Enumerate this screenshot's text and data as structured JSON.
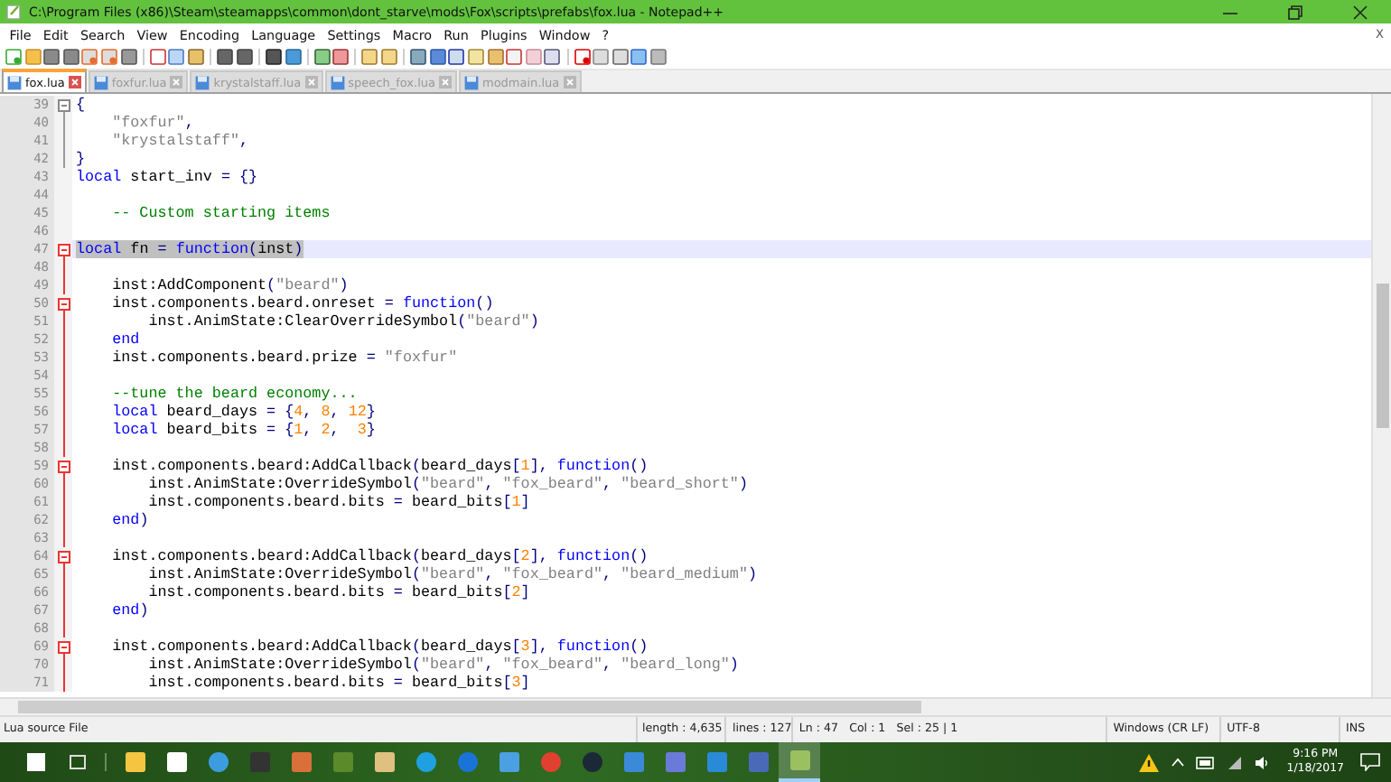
{
  "window": {
    "title": "C:\\Program Files (x86)\\Steam\\steamapps\\common\\dont_starve\\mods\\Fox\\scripts\\prefabs\\fox.lua - Notepad++"
  },
  "menu": [
    "File",
    "Edit",
    "Search",
    "View",
    "Encoding",
    "Language",
    "Settings",
    "Macro",
    "Run",
    "Plugins",
    "Window",
    "?"
  ],
  "menu_close": "X",
  "tabs": [
    {
      "label": "fox.lua",
      "selected": true
    },
    {
      "label": "foxfur.lua",
      "selected": false
    },
    {
      "label": "krystalstaff.lua",
      "selected": false
    },
    {
      "label": "speech_fox.lua",
      "selected": false
    },
    {
      "label": "modmain.lua",
      "selected": false
    }
  ],
  "lines": [
    {
      "n": "39",
      "fold_box": true,
      "fold_line": true,
      "fold_active": false,
      "selected": false,
      "tokens": [
        {
          "kind": "op",
          "text": "{"
        }
      ]
    },
    {
      "n": "40",
      "fold_box": false,
      "fold_line": true,
      "fold_active": false,
      "selected": false,
      "tokens": [
        {
          "kind": "str",
          "text": "    \"foxfur\""
        },
        {
          "kind": "op",
          "text": ","
        }
      ]
    },
    {
      "n": "41",
      "fold_box": false,
      "fold_line": true,
      "fold_active": false,
      "selected": false,
      "tokens": [
        {
          "kind": "str",
          "text": "    \"krystalstaff\""
        },
        {
          "kind": "op",
          "text": ","
        }
      ]
    },
    {
      "n": "42",
      "fold_box": false,
      "fold_line": true,
      "fold_active": false,
      "selected": false,
      "tokens": [
        {
          "kind": "op",
          "text": "}"
        }
      ]
    },
    {
      "n": "43",
      "fold_box": false,
      "fold_line": false,
      "selected": false,
      "tokens": [
        {
          "kind": "kw",
          "text": "local"
        },
        {
          "kind": "id",
          "text": " start_inv "
        },
        {
          "kind": "op",
          "text": "= {}"
        }
      ]
    },
    {
      "n": "44",
      "fold_box": false,
      "fold_line": false,
      "selected": false
    },
    {
      "n": "45",
      "fold_box": false,
      "fold_line": false,
      "selected": false,
      "tokens": [
        {
          "kind": "cmt",
          "text": "    -- Custom starting items"
        }
      ]
    },
    {
      "n": "46",
      "fold_box": false,
      "fold_line": false,
      "selected": false
    },
    {
      "n": "47",
      "fold_box": true,
      "fold_line": true,
      "fold_active": true,
      "selected": true,
      "tokens": [
        {
          "kind": "kw",
          "text": "local"
        },
        {
          "kind": "id",
          "text": " fn "
        },
        {
          "kind": "op",
          "text": "= "
        },
        {
          "kind": "kw",
          "text": "function"
        },
        {
          "kind": "op",
          "text": "("
        },
        {
          "kind": "id",
          "text": "inst"
        },
        {
          "kind": "op",
          "text": ")"
        }
      ]
    },
    {
      "n": "48",
      "fold_box": false,
      "fold_line": true,
      "fold_active": true,
      "selected": false
    },
    {
      "n": "49",
      "fold_box": false,
      "fold_line": true,
      "fold_active": true,
      "selected": false,
      "tokens": [
        {
          "kind": "id",
          "text": "    inst:AddComponent"
        },
        {
          "kind": "op",
          "text": "("
        },
        {
          "kind": "str",
          "text": "\"beard\""
        },
        {
          "kind": "op",
          "text": ")"
        }
      ]
    },
    {
      "n": "50",
      "fold_box": true,
      "fold_line": true,
      "fold_active": true,
      "selected": false,
      "tokens": [
        {
          "kind": "id",
          "text": "    inst.components.beard.onreset "
        },
        {
          "kind": "op",
          "text": "= "
        },
        {
          "kind": "kw",
          "text": "function"
        },
        {
          "kind": "op",
          "text": "()"
        }
      ]
    },
    {
      "n": "51",
      "fold_box": false,
      "fold_line": true,
      "fold_active": true,
      "selected": false,
      "tokens": [
        {
          "kind": "id",
          "text": "        inst.AnimState:ClearOverrideSymbol"
        },
        {
          "kind": "op",
          "text": "("
        },
        {
          "kind": "str",
          "text": "\"beard\""
        },
        {
          "kind": "op",
          "text": ")"
        }
      ]
    },
    {
      "n": "52",
      "fold_box": false,
      "fold_line": true,
      "fold_active": true,
      "selected": false,
      "tokens": [
        {
          "kind": "kw",
          "text": "    end"
        }
      ]
    },
    {
      "n": "53",
      "fold_box": false,
      "fold_line": true,
      "fold_active": true,
      "selected": false,
      "tokens": [
        {
          "kind": "id",
          "text": "    inst.components.beard.prize "
        },
        {
          "kind": "op",
          "text": "= "
        },
        {
          "kind": "str",
          "text": "\"foxfur\""
        }
      ]
    },
    {
      "n": "54",
      "fold_box": false,
      "fold_line": true,
      "fold_active": true,
      "selected": false
    },
    {
      "n": "55",
      "fold_box": false,
      "fold_line": true,
      "fold_active": true,
      "selected": false,
      "tokens": [
        {
          "kind": "cmt",
          "text": "    --tune the beard economy..."
        }
      ]
    },
    {
      "n": "56",
      "fold_box": false,
      "fold_line": true,
      "fold_active": true,
      "selected": false,
      "tokens": [
        {
          "kind": "kw",
          "text": "    local"
        },
        {
          "kind": "id",
          "text": " beard_days "
        },
        {
          "kind": "op",
          "text": "= {"
        },
        {
          "kind": "num",
          "text": "4"
        },
        {
          "kind": "op",
          "text": ", "
        },
        {
          "kind": "num",
          "text": "8"
        },
        {
          "kind": "op",
          "text": ", "
        },
        {
          "kind": "num",
          "text": "12"
        },
        {
          "kind": "op",
          "text": "}"
        }
      ]
    },
    {
      "n": "57",
      "fold_box": false,
      "fold_line": true,
      "fold_active": true,
      "selected": false,
      "tokens": [
        {
          "kind": "kw",
          "text": "    local"
        },
        {
          "kind": "id",
          "text": " beard_bits "
        },
        {
          "kind": "op",
          "text": "= {"
        },
        {
          "kind": "num",
          "text": "1"
        },
        {
          "kind": "op",
          "text": ", "
        },
        {
          "kind": "num",
          "text": "2"
        },
        {
          "kind": "op",
          "text": ",  "
        },
        {
          "kind": "num",
          "text": "3"
        },
        {
          "kind": "op",
          "text": "}"
        }
      ]
    },
    {
      "n": "58",
      "fold_box": false,
      "fold_line": true,
      "fold_active": true,
      "selected": false
    },
    {
      "n": "59",
      "fold_box": true,
      "fold_line": true,
      "fold_active": true,
      "selected": false,
      "tokens": [
        {
          "kind": "id",
          "text": "    inst.components.beard:AddCallback"
        },
        {
          "kind": "op",
          "text": "("
        },
        {
          "kind": "id",
          "text": "beard_days"
        },
        {
          "kind": "op",
          "text": "["
        },
        {
          "kind": "num",
          "text": "1"
        },
        {
          "kind": "op",
          "text": "], "
        },
        {
          "kind": "kw",
          "text": "function"
        },
        {
          "kind": "op",
          "text": "()"
        }
      ]
    },
    {
      "n": "60",
      "fold_box": false,
      "fold_line": true,
      "fold_active": true,
      "selected": false,
      "tokens": [
        {
          "kind": "id",
          "text": "        inst.AnimState:OverrideSymbol"
        },
        {
          "kind": "op",
          "text": "("
        },
        {
          "kind": "str",
          "text": "\"beard\""
        },
        {
          "kind": "op",
          "text": ", "
        },
        {
          "kind": "str",
          "text": "\"fox_beard\""
        },
        {
          "kind": "op",
          "text": ", "
        },
        {
          "kind": "str",
          "text": "\"beard_short\""
        },
        {
          "kind": "op",
          "text": ")"
        }
      ]
    },
    {
      "n": "61",
      "fold_box": false,
      "fold_line": true,
      "fold_active": true,
      "selected": false,
      "tokens": [
        {
          "kind": "id",
          "text": "        inst.components.beard.bits "
        },
        {
          "kind": "op",
          "text": "= "
        },
        {
          "kind": "id",
          "text": "beard_bits"
        },
        {
          "kind": "op",
          "text": "["
        },
        {
          "kind": "num",
          "text": "1"
        },
        {
          "kind": "op",
          "text": "]"
        }
      ]
    },
    {
      "n": "62",
      "fold_box": false,
      "fold_line": true,
      "fold_active": true,
      "selected": false,
      "tokens": [
        {
          "kind": "kw",
          "text": "    end"
        },
        {
          "kind": "op",
          "text": ")"
        }
      ]
    },
    {
      "n": "63",
      "fold_box": false,
      "fold_line": true,
      "fold_active": true,
      "selected": false
    },
    {
      "n": "64",
      "fold_box": true,
      "fold_line": true,
      "fold_active": true,
      "selected": false,
      "tokens": [
        {
          "kind": "id",
          "text": "    inst.components.beard:AddCallback"
        },
        {
          "kind": "op",
          "text": "("
        },
        {
          "kind": "id",
          "text": "beard_days"
        },
        {
          "kind": "op",
          "text": "["
        },
        {
          "kind": "num",
          "text": "2"
        },
        {
          "kind": "op",
          "text": "], "
        },
        {
          "kind": "kw",
          "text": "function"
        },
        {
          "kind": "op",
          "text": "()"
        }
      ]
    },
    {
      "n": "65",
      "fold_box": false,
      "fold_line": true,
      "fold_active": true,
      "selected": false,
      "tokens": [
        {
          "kind": "id",
          "text": "        inst.AnimState:OverrideSymbol"
        },
        {
          "kind": "op",
          "text": "("
        },
        {
          "kind": "str",
          "text": "\"beard\""
        },
        {
          "kind": "op",
          "text": ", "
        },
        {
          "kind": "str",
          "text": "\"fox_beard\""
        },
        {
          "kind": "op",
          "text": ", "
        },
        {
          "kind": "str",
          "text": "\"beard_medium\""
        },
        {
          "kind": "op",
          "text": ")"
        }
      ]
    },
    {
      "n": "66",
      "fold_box": false,
      "fold_line": true,
      "fold_active": true,
      "selected": false,
      "tokens": [
        {
          "kind": "id",
          "text": "        inst.components.beard.bits "
        },
        {
          "kind": "op",
          "text": "= "
        },
        {
          "kind": "id",
          "text": "beard_bits"
        },
        {
          "kind": "op",
          "text": "["
        },
        {
          "kind": "num",
          "text": "2"
        },
        {
          "kind": "op",
          "text": "]"
        }
      ]
    },
    {
      "n": "67",
      "fold_box": false,
      "fold_line": true,
      "fold_active": true,
      "selected": false,
      "tokens": [
        {
          "kind": "kw",
          "text": "    end"
        },
        {
          "kind": "op",
          "text": ")"
        }
      ]
    },
    {
      "n": "68",
      "fold_box": false,
      "fold_line": true,
      "fold_active": true,
      "selected": false
    },
    {
      "n": "69",
      "fold_box": true,
      "fold_line": true,
      "fold_active": true,
      "selected": false,
      "tokens": [
        {
          "kind": "id",
          "text": "    inst.components.beard:AddCallback"
        },
        {
          "kind": "op",
          "text": "("
        },
        {
          "kind": "id",
          "text": "beard_days"
        },
        {
          "kind": "op",
          "text": "["
        },
        {
          "kind": "num",
          "text": "3"
        },
        {
          "kind": "op",
          "text": "], "
        },
        {
          "kind": "kw",
          "text": "function"
        },
        {
          "kind": "op",
          "text": "()"
        }
      ]
    },
    {
      "n": "70",
      "fold_box": false,
      "fold_line": true,
      "fold_active": true,
      "selected": false,
      "tokens": [
        {
          "kind": "id",
          "text": "        inst.AnimState:OverrideSymbol"
        },
        {
          "kind": "op",
          "text": "("
        },
        {
          "kind": "str",
          "text": "\"beard\""
        },
        {
          "kind": "op",
          "text": ", "
        },
        {
          "kind": "str",
          "text": "\"fox_beard\""
        },
        {
          "kind": "op",
          "text": ", "
        },
        {
          "kind": "str",
          "text": "\"beard_long\""
        },
        {
          "kind": "op",
          "text": ")"
        }
      ]
    },
    {
      "n": "71",
      "fold_box": false,
      "fold_line": true,
      "fold_active": true,
      "selected": false,
      "tokens": [
        {
          "kind": "id",
          "text": "        inst.components.beard.bits "
        },
        {
          "kind": "op",
          "text": "= "
        },
        {
          "kind": "id",
          "text": "beard_bits"
        },
        {
          "kind": "op",
          "text": "["
        },
        {
          "kind": "num",
          "text": "3"
        },
        {
          "kind": "op",
          "text": "]"
        }
      ]
    }
  ],
  "status_bar": {
    "file_type": "Lua source File",
    "length": "length : 4,635",
    "lines": "lines : 127",
    "ln": "Ln : 47",
    "col": "Col : 1",
    "sel": "Sel : 25 | 1",
    "eol": "Windows (CR LF)",
    "encoding": "UTF-8",
    "mode": "INS"
  },
  "taskbar": {
    "time": "9:16 PM",
    "date": "1/18/2017"
  }
}
